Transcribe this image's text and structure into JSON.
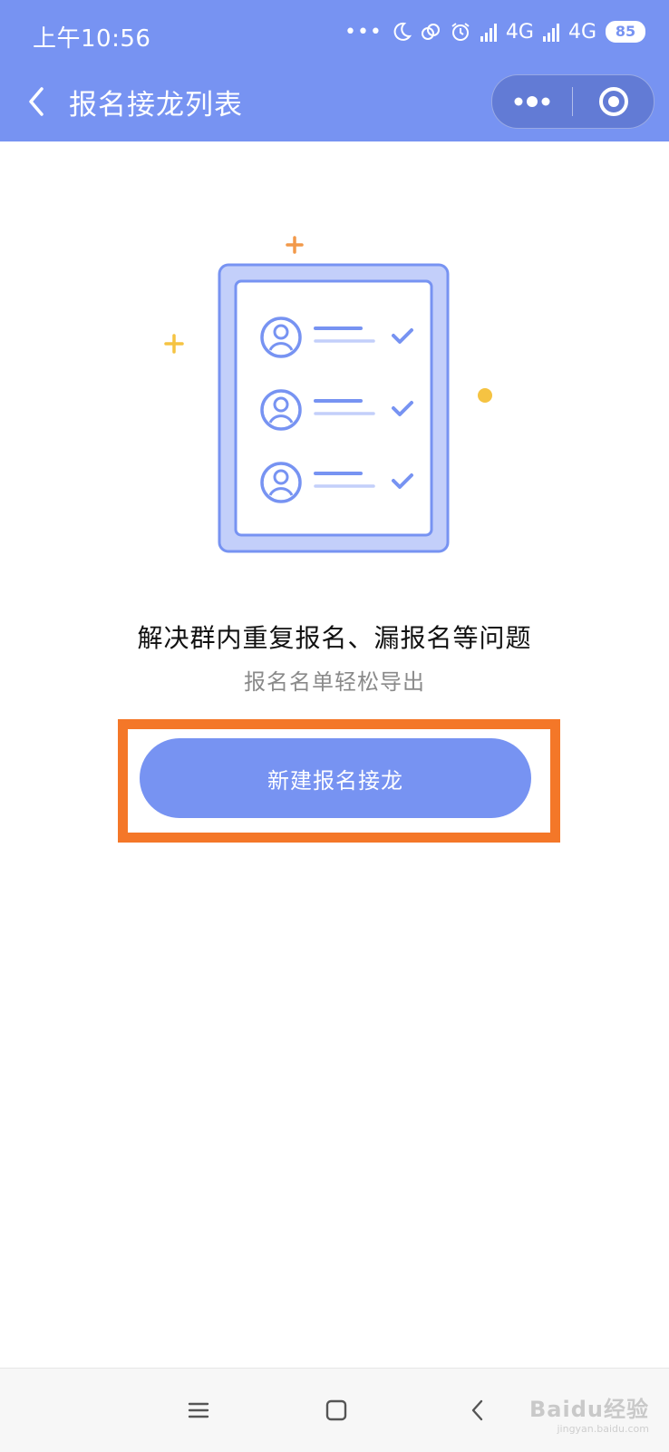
{
  "status_bar": {
    "time": "上午10:56",
    "network_1": "4G",
    "network_2": "4G",
    "battery": "85"
  },
  "nav": {
    "title": "报名接龙列表"
  },
  "main": {
    "headline": "解决群内重复报名、漏报名等问题",
    "subline": "报名名单轻松导出",
    "create_button_label": "新建报名接龙"
  },
  "watermark": {
    "text": "Baidu经验",
    "url": "jingyan.baidu.com"
  },
  "colors": {
    "primary": "#7793F2",
    "highlight": "#F47728",
    "accent_orange": "#F2994A",
    "accent_yellow": "#F5C342"
  },
  "icons": {
    "back": "chevron-left-icon",
    "more": "more-dots-icon",
    "close": "target-circle-icon",
    "menu": "menu-icon",
    "home": "home-square-icon",
    "back_nav": "back-triangle-icon"
  }
}
